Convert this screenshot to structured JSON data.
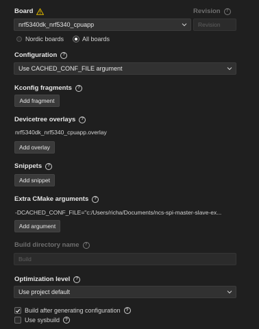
{
  "board": {
    "label": "Board",
    "value": "nrf5340dk_nrf5340_cpuapp",
    "options": {
      "nordic": "Nordic boards",
      "all": "All boards"
    },
    "selected_option": "All boards"
  },
  "revision": {
    "label": "Revision",
    "placeholder": "Revision"
  },
  "configuration": {
    "label": "Configuration",
    "value": "Use CACHED_CONF_FILE argument"
  },
  "kconfig": {
    "label": "Kconfig fragments",
    "button": "Add fragment"
  },
  "devicetree": {
    "label": "Devicetree overlays",
    "value": "nrf5340dk_nrf5340_cpuapp.overlay",
    "button": "Add overlay"
  },
  "snippets": {
    "label": "Snippets",
    "button": "Add snippet"
  },
  "cmake": {
    "label": "Extra CMake arguments",
    "value": "-DCACHED_CONF_FILE=\"c:/Users/richa/Documents/ncs-spi-master-slave-ex...",
    "button": "Add argument"
  },
  "build_dir": {
    "label": "Build directory name",
    "placeholder": "Build"
  },
  "optimization": {
    "label": "Optimization level",
    "value": "Use project default"
  },
  "build_after": {
    "label": "Build after generating configuration",
    "checked": true
  },
  "sysbuild": {
    "label": "Use sysbuild",
    "checked": false
  },
  "colors": {
    "warning": "#cca700",
    "background": "#1f1f1f"
  }
}
